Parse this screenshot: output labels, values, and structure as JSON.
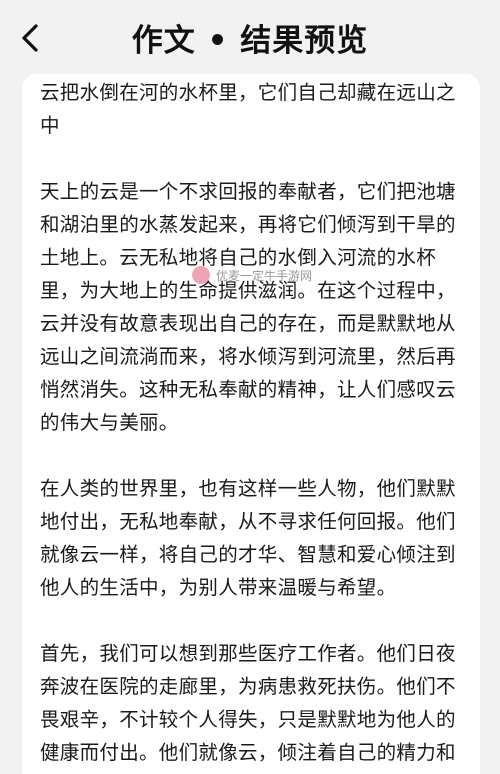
{
  "header": {
    "title": "作文 • 结果预览",
    "back_icon": "chevron-left-icon"
  },
  "article": {
    "heading": "云把水倒在河的水杯里，它们自己却藏在远山之中",
    "paragraphs": [
      "天上的云是一个不求回报的奉献者，它们把池塘和湖泊里的水蒸发起来，再将它们倾泻到干旱的土地上。云无私地将自己的水倒入河流的水杯里，为大地上的生命提供滋润。在这个过程中，云并没有故意表现出自己的存在，而是默默地从远山之间流淌而来，将水倾泻到河流里，然后再悄然消失。这种无私奉献的精神，让人们感叹云的伟大与美丽。",
      "在人类的世界里，也有这样一些人物，他们默默地付出，无私地奉献，从不寻求任何回报。他们就像云一样，将自己的才华、智慧和爱心倾注到他人的生活中，为别人带来温暖与希望。",
      "首先，我们可以想到那些医疗工作者。他们日夜奔波在医院的走廊里，为病患救死扶伤。他们不畏艰辛，不计较个人得失，只是默默地为他人的健康而付出。他们就像云，倾注着自己的精力和专业知识，让患者们摆脱病痛，重获健康。"
    ]
  },
  "watermark": {
    "text": "优麦一定牛手游网"
  },
  "colors": {
    "background": "#f2f2f2",
    "card": "#ffffff",
    "text": "#1a1a1a"
  }
}
